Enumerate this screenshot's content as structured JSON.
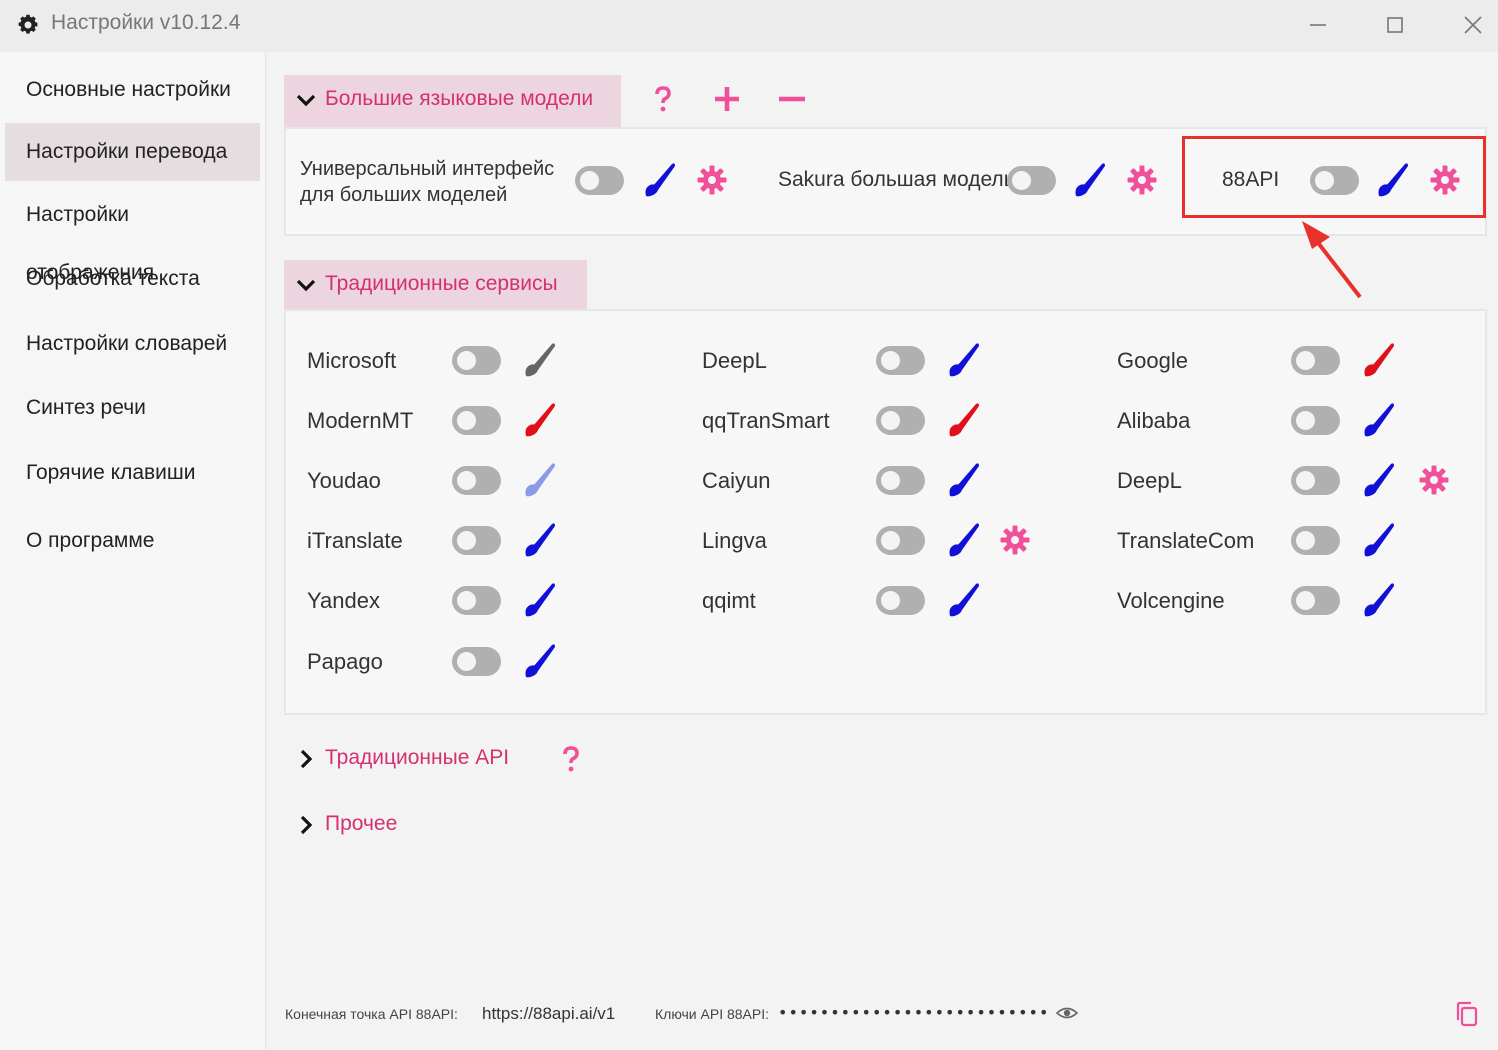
{
  "window": {
    "title": "Настройки v10.12.4"
  },
  "sidebar": {
    "items": [
      {
        "label": "Основные настройки",
        "active": false
      },
      {
        "label": "Настройки перевода",
        "active": true
      },
      {
        "label": "Настройки отображения",
        "active": false
      },
      {
        "label": "Обработка текста",
        "active": false
      },
      {
        "label": "Настройки словарей",
        "active": false
      },
      {
        "label": "Синтез речи",
        "active": false
      },
      {
        "label": "Горячие клавиши",
        "active": false
      },
      {
        "label": "О программе",
        "active": false
      }
    ]
  },
  "sections": {
    "llm": {
      "title": "Большие языковые модели",
      "expanded": true,
      "items": [
        {
          "name": "Универсальный интерфейс для больших моделей",
          "line1": "Универсальный интерфейс",
          "line2": "для больших моделей",
          "enabled": false,
          "brush_color": "#1010d8",
          "has_settings": true
        },
        {
          "name": "Sakura большая модель",
          "enabled": false,
          "brush_color": "#1010d8",
          "has_settings": true
        },
        {
          "name": "88API",
          "enabled": false,
          "brush_color": "#1010d8",
          "has_settings": true,
          "highlighted": true
        }
      ]
    },
    "traditional": {
      "title": "Традиционные сервисы",
      "expanded": true,
      "items": [
        {
          "name": "Microsoft",
          "enabled": false,
          "brush_color": "#666666",
          "has_settings": false
        },
        {
          "name": "ModernMT",
          "enabled": false,
          "brush_color": "#e0101a",
          "has_settings": false
        },
        {
          "name": "Youdao",
          "enabled": false,
          "brush_color": "#8a9ae8",
          "has_settings": false
        },
        {
          "name": "iTranslate",
          "enabled": false,
          "brush_color": "#1010d8",
          "has_settings": false
        },
        {
          "name": "Yandex",
          "enabled": false,
          "brush_color": "#1010d8",
          "has_settings": false
        },
        {
          "name": "Papago",
          "enabled": false,
          "brush_color": "#1010d8",
          "has_settings": false
        },
        {
          "name": "DeepL",
          "enabled": false,
          "brush_color": "#1010d8",
          "has_settings": false
        },
        {
          "name": "qqTranSmart",
          "enabled": false,
          "brush_color": "#e0101a",
          "has_settings": false
        },
        {
          "name": "Caiyun",
          "enabled": false,
          "brush_color": "#1010d8",
          "has_settings": false
        },
        {
          "name": "Lingva",
          "enabled": false,
          "brush_color": "#1010d8",
          "has_settings": true
        },
        {
          "name": "qqimt",
          "enabled": false,
          "brush_color": "#1010d8",
          "has_settings": false
        },
        {
          "name": "Google",
          "enabled": false,
          "brush_color": "#e0101a",
          "has_settings": false
        },
        {
          "name": "Alibaba",
          "enabled": false,
          "brush_color": "#1010d8",
          "has_settings": false
        },
        {
          "name": "DeepL",
          "enabled": false,
          "brush_color": "#1010d8",
          "has_settings": true
        },
        {
          "name": "TranslateCom",
          "enabled": false,
          "brush_color": "#1010d8",
          "has_settings": false
        },
        {
          "name": "Volcengine",
          "enabled": false,
          "brush_color": "#1010d8",
          "has_settings": false
        }
      ]
    },
    "traditional_api": {
      "title": "Традиционные API",
      "expanded": false
    },
    "other": {
      "title": "Прочее",
      "expanded": false
    }
  },
  "footer": {
    "endpoint_label": "Конечная точка API 88API:",
    "endpoint_value": "https://88api.ai/v1",
    "keys_label": "Ключи API 88API:",
    "keys_value": "•••••••••••••••••••••••••••••••••••••"
  },
  "colors": {
    "accent": "#d5306e",
    "icon_pink": "#f0509a",
    "highlight_red": "#e8312a",
    "toggle_off": "#b0b0b0"
  },
  "icons": {
    "app": "gear-icon",
    "help": "question-icon",
    "add": "plus-icon",
    "remove": "minus-icon",
    "expanded": "chevron-down-icon",
    "collapsed": "chevron-right-icon",
    "color": "brush-icon",
    "settings": "gear-icon",
    "reveal": "eye-icon",
    "copy": "copy-icon"
  }
}
